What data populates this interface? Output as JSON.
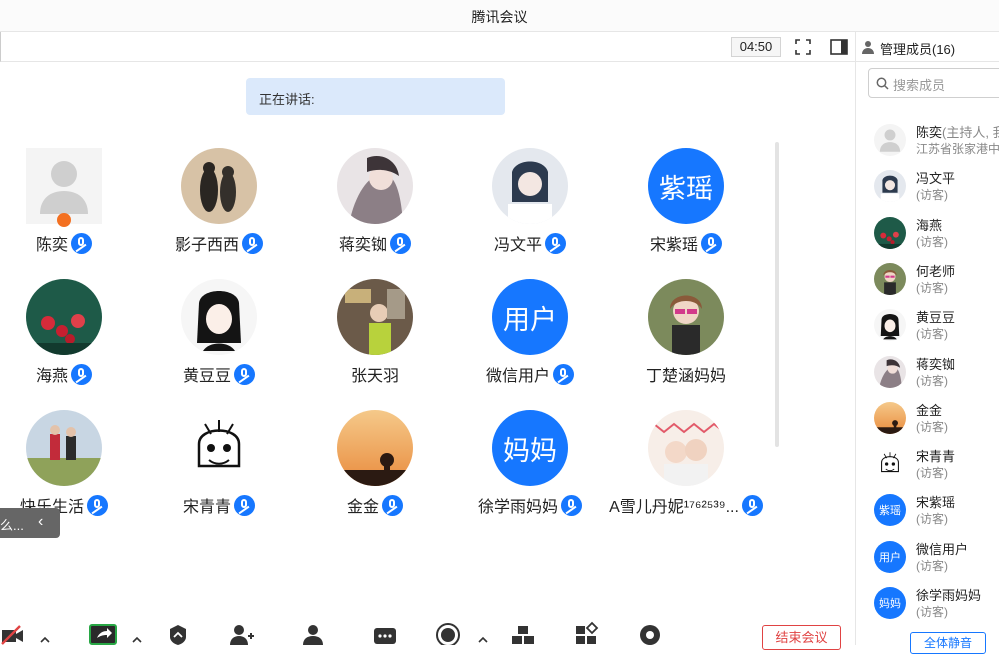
{
  "window": {
    "title": "腾讯会议"
  },
  "toolbar": {
    "timer": "04:50"
  },
  "speaking": {
    "label": "正在讲话:"
  },
  "participants": [
    {
      "name": "陈奕",
      "avatar": "default-person",
      "mic": true,
      "host_badge": true
    },
    {
      "name": "影子西西",
      "avatar": "photo",
      "mic": true
    },
    {
      "name": "蒋奕铷",
      "avatar": "photo",
      "mic": true
    },
    {
      "name": "冯文平",
      "avatar": "photo",
      "mic": true
    },
    {
      "name": "宋紫瑶",
      "avatar_text": "紫瑶",
      "mic": true
    },
    {
      "name": "海燕",
      "avatar": "photo",
      "mic": true
    },
    {
      "name": "黄豆豆",
      "avatar": "photo",
      "mic": true
    },
    {
      "name": "张天羽",
      "avatar": "photo",
      "mic": false
    },
    {
      "name": "微信用户",
      "avatar_text": "用户",
      "mic": true
    },
    {
      "name": "丁楚涵妈妈",
      "avatar": "photo",
      "mic": false
    },
    {
      "name": "快乐生活",
      "avatar": "photo",
      "mic": true
    },
    {
      "name": "宋青青",
      "avatar": "photo",
      "mic": true
    },
    {
      "name": "金金",
      "avatar": "photo",
      "mic": true
    },
    {
      "name": "徐学雨妈妈",
      "avatar_text": "妈妈",
      "mic": true
    },
    {
      "name": "A雪儿丹妮¹⁷⁶²⁵³⁹...",
      "avatar": "photo",
      "mic": true
    }
  ],
  "collapse_tab": {
    "text": "么..."
  },
  "bottom": {
    "end_meeting": "结束会议"
  },
  "panel": {
    "title": "管理成员(16)",
    "search_placeholder": "搜索成员",
    "mute_all": "全体静音",
    "members": [
      {
        "name": "陈奕",
        "extra": "(主持人, 我)",
        "sub": "江苏省张家港中"
      },
      {
        "name": "冯文平",
        "sub": "(访客)"
      },
      {
        "name": "海燕",
        "sub": "(访客)"
      },
      {
        "name": "何老师",
        "sub": "(访客)"
      },
      {
        "name": "黄豆豆",
        "sub": "(访客)"
      },
      {
        "name": "蒋奕铷",
        "sub": "(访客)"
      },
      {
        "name": "金金",
        "sub": "(访客)"
      },
      {
        "name": "宋青青",
        "sub": "(访客)"
      },
      {
        "name": "宋紫瑶",
        "sub": "(访客)",
        "avatar_text": "紫瑶"
      },
      {
        "name": "微信用户",
        "sub": "(访客)",
        "avatar_text": "用户"
      },
      {
        "name": "徐学雨妈妈",
        "sub": "(访客)",
        "avatar_text": "妈妈"
      }
    ]
  },
  "colors": {
    "accent": "#1677ff",
    "host_badge": "#f37021",
    "end": "#e04343",
    "speaking_bg": "#dbe9fb"
  }
}
